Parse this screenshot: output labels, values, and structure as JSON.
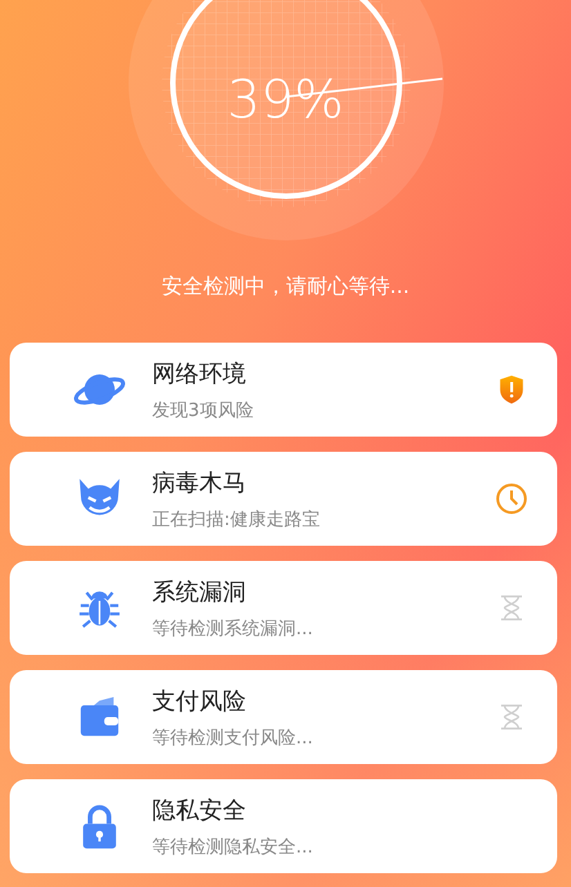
{
  "scanner": {
    "percent": "39%",
    "message": "安全检测中，请耐心等待..."
  },
  "checks": [
    {
      "title": "网络环境",
      "detail": "发现3项风险",
      "kind": "risk"
    },
    {
      "title": "病毒木马",
      "detail": "正在扫描:健康走路宝",
      "kind": "scanning"
    },
    {
      "title": "系统漏洞",
      "detail": "等待检测系统漏洞...",
      "kind": "waiting"
    },
    {
      "title": "支付风险",
      "detail": "等待检测支付风险...",
      "kind": "waiting"
    },
    {
      "title": "隐私安全",
      "detail": "等待检测隐私安全..."
    }
  ]
}
